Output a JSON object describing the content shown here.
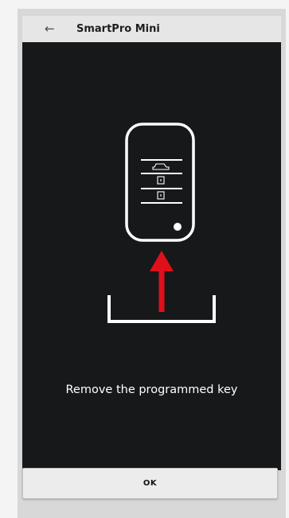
{
  "appbar": {
    "title": "SmartPro Mini",
    "back_icon": "arrow-left-icon"
  },
  "screen": {
    "message": "Remove the programmed key",
    "illustration_icons": [
      "car-key-fob-icon",
      "car-icon",
      "lock-icon",
      "unlock-icon",
      "up-arrow-icon",
      "key-slot-icon"
    ],
    "colors": {
      "background": "#17181a",
      "arrow": "#e0101a",
      "line": "#ffffff"
    }
  },
  "footer": {
    "ok_label": "OK"
  }
}
